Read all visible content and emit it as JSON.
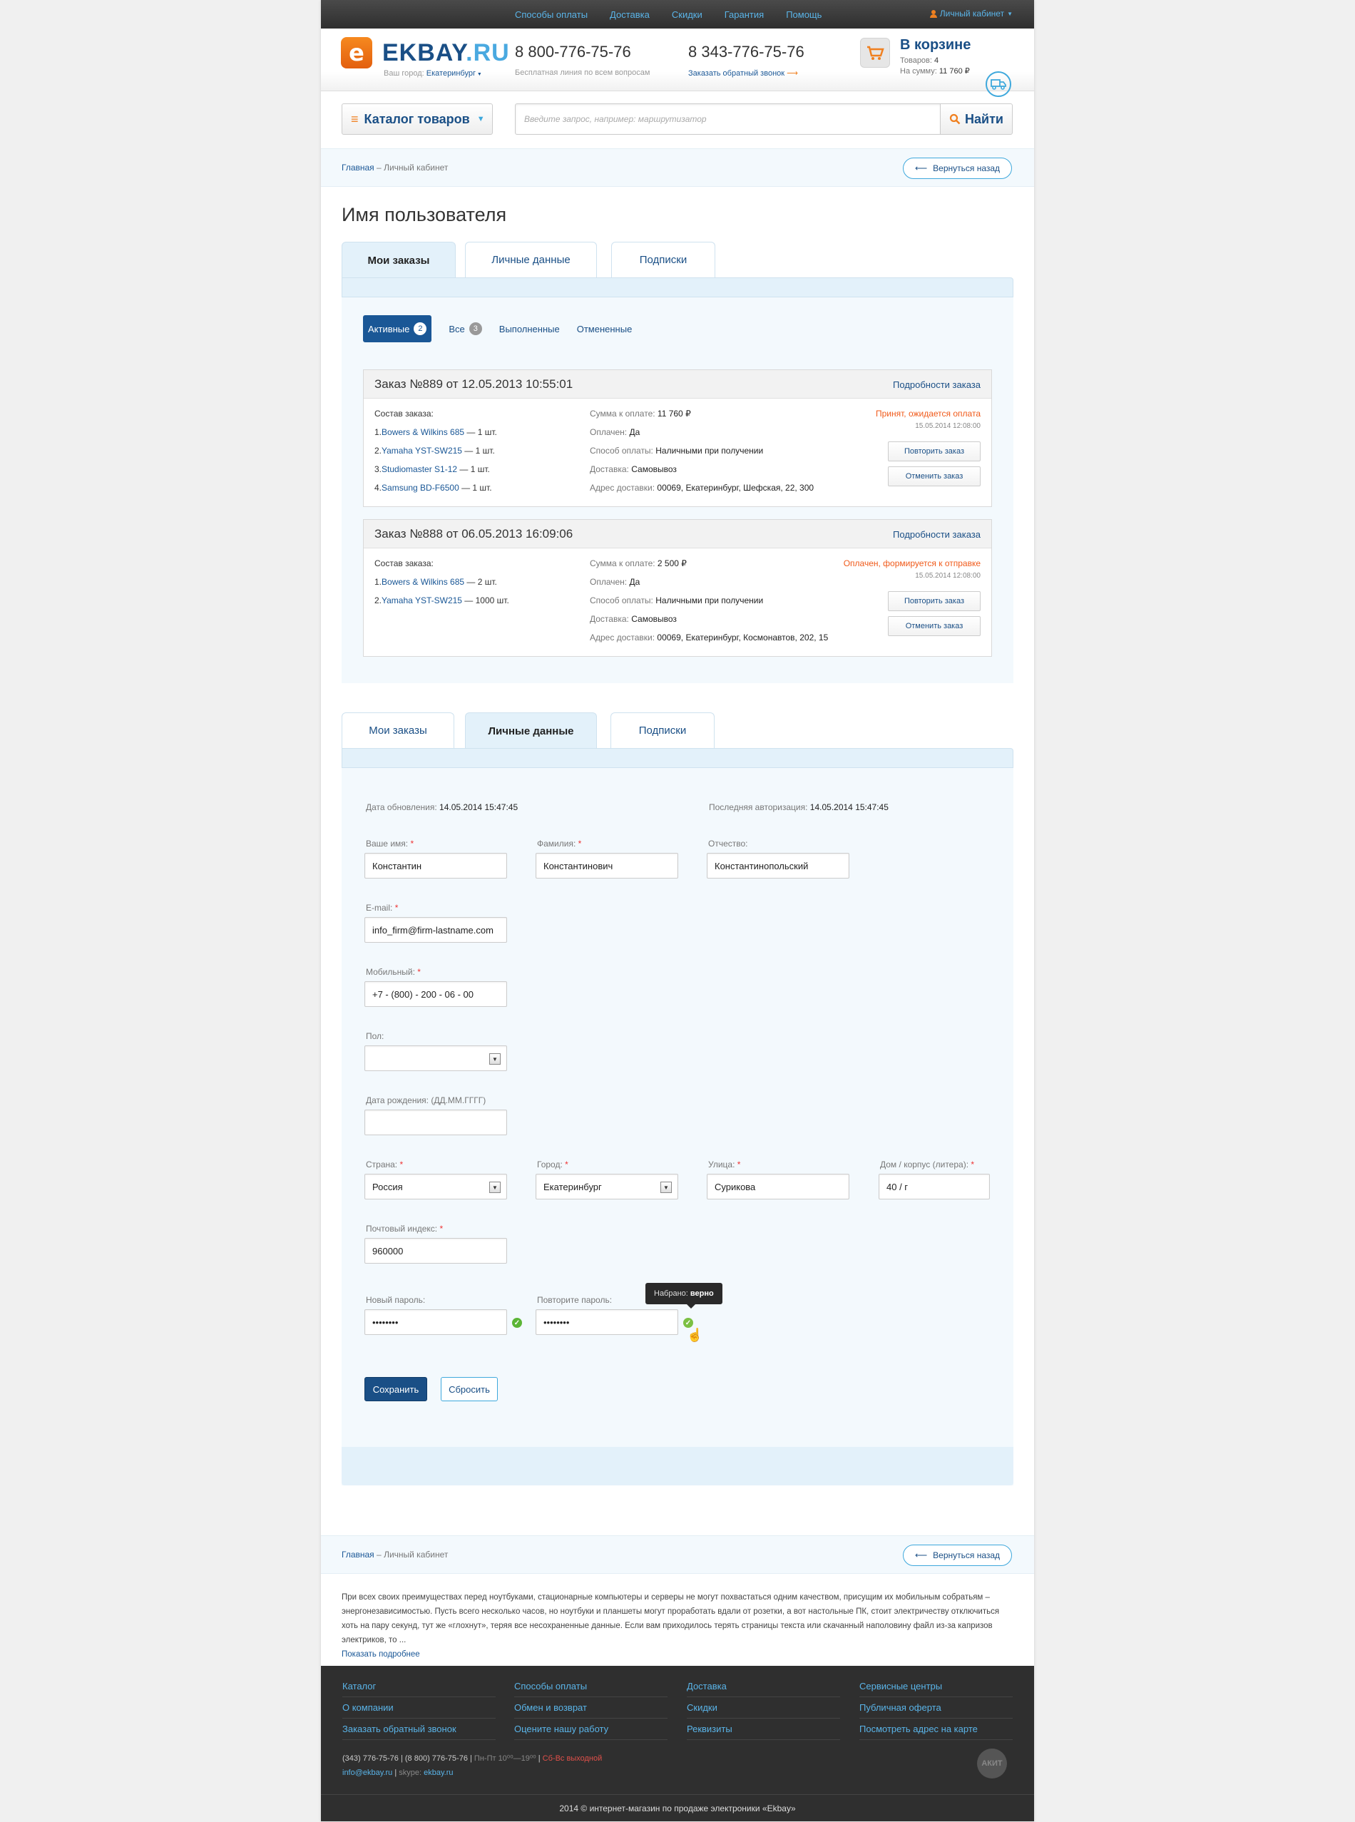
{
  "topbar": {
    "nav": [
      "Способы оплаты",
      "Доставка",
      "Скидки",
      "Гарантия",
      "Помощь"
    ],
    "cabinet": "Личный кабинет"
  },
  "header": {
    "logo_ek": "EKBAY",
    "logo_ru": ".RU",
    "city_label": "Ваш город:",
    "city": "Екатеринбург",
    "phone1": "8 800-776-75-76",
    "phone1_sub": "Бесплатная линия по всем вопросам",
    "phone2": "8 343-776-75-76",
    "phone2_sub": "Заказать обратный звонок",
    "cart_title": "В корзине",
    "cart_items_label": "Товаров:",
    "cart_items": "4",
    "cart_sum_label": "На сумму:",
    "cart_sum": "11 760 ₽"
  },
  "search": {
    "catalog": "Каталог товаров",
    "placeholder": "Введите запрос, например: маршрутизатор",
    "button": "Найти"
  },
  "breadcrumb": {
    "home": "Главная",
    "sep": "–",
    "current": "Личный кабинет",
    "back": "Вернуться назад"
  },
  "page_title": "Имя пользователя",
  "tabs": [
    "Мои заказы",
    "Личные данные",
    "Подписки"
  ],
  "filters": {
    "active": "Активные",
    "active_count": "2",
    "all": "Все",
    "all_count": "3",
    "done": "Выполненные",
    "cancelled": "Отмененные"
  },
  "orders": [
    {
      "title": "Заказ №889 от 12.05.2013 10:55:01",
      "details": "Подробности заказа",
      "composition": "Состав заказа:",
      "items": [
        {
          "num": "1.",
          "name": "Bowers & Wilkins 685",
          "qty": " — 1 шт."
        },
        {
          "num": "2.",
          "name": "Yamaha YST-SW215",
          "qty": " — 1 шт."
        },
        {
          "num": "3.",
          "name": "Studiomaster S1-12",
          "qty": " — 1 шт."
        },
        {
          "num": "4.",
          "name": "Samsung BD-F6500",
          "qty": " — 1 шт."
        }
      ],
      "info": [
        {
          "label": "Сумма к оплате:",
          "value": "11 760 ₽"
        },
        {
          "label": "Оплачен:",
          "value": "Да"
        },
        {
          "label": "Способ оплаты:",
          "value": "Наличными при получении"
        },
        {
          "label": "Доставка:",
          "value": "Самовывоз"
        },
        {
          "label": "Адрес доставки:",
          "value": "00069, Екатеринбург, Шефская, 22, 300"
        }
      ],
      "status": "Принят, ожидается оплата",
      "status_date": "15.05.2014 12:08:00",
      "repeat": "Повторить заказ",
      "cancel": "Отменить заказ"
    },
    {
      "title": "Заказ №888 от 06.05.2013 16:09:06",
      "details": "Подробности заказа",
      "composition": "Состав заказа:",
      "items": [
        {
          "num": "1.",
          "name": "Bowers & Wilkins 685",
          "qty": " — 2 шт."
        },
        {
          "num": "2.",
          "name": "Yamaha YST-SW215",
          "qty": " — 1000 шт."
        }
      ],
      "info": [
        {
          "label": "Сумма к оплате:",
          "value": "2 500 ₽"
        },
        {
          "label": "Оплачен:",
          "value": "Да"
        },
        {
          "label": "Способ оплаты:",
          "value": "Наличными при получении"
        },
        {
          "label": "Доставка:",
          "value": "Самовывоз"
        },
        {
          "label": "Адрес доставки:",
          "value": "00069, Екатеринбург, Космонавтов, 202, 15"
        }
      ],
      "status": "Оплачен, формируется к отправке",
      "status_date": "15.05.2014 12:08:00",
      "repeat": "Повторить заказ",
      "cancel": "Отменить заказ"
    }
  ],
  "profile": {
    "updated_label": "Дата обновления:",
    "updated": "14.05.2014 15:47:45",
    "lastlogin_label": "Последняя авторизация:",
    "lastlogin": "14.05.2014 15:47:45",
    "name_label": "Ваше имя:",
    "name": "Константин",
    "surname_label": "Фамилия:",
    "surname": "Константинович",
    "patronymic_label": "Отчество:",
    "patronymic": "Константинопольский",
    "email_label": "E-mail:",
    "email": "info_firm@firm-lastname.com",
    "mobile_label": "Мобильный:",
    "mobile": "+7 - (800) - 200 - 06 - 00",
    "gender_label": "Пол:",
    "gender": "",
    "birth_label": "Дата рождения: (ДД.ММ.ГГГГ)",
    "birth": "",
    "country_label": "Страна:",
    "country": "Россия",
    "city_label": "Город:",
    "city": "Екатеринбург",
    "street_label": "Улица:",
    "street": "Сурикова",
    "house_label": "Дом / корпус (литера):",
    "house": "40 / г",
    "zip_label": "Почтовый индекс:",
    "zip": "960000",
    "newpass_label": "Новый пароль:",
    "newpass": "••••••••",
    "repeatpass_label": "Повторите пароль:",
    "repeatpass": "••••••••",
    "req": "*",
    "tooltip_label": "Набрано:",
    "tooltip_value": "верно",
    "save": "Сохранить",
    "reset": "Сбросить"
  },
  "description": {
    "text": "При всех своих преимуществах перед ноутбуками, стационарные компьютеры и серверы не могут похвастаться одним качеством, присущим их мобильным собратьям – энергонезависимостью. Пусть всего несколько часов, но ноутбуки и планшеты могут проработать вдали от розетки, а вот настольные ПК, стоит электричеству отключиться хоть на пару секунд, тут же «глохнут», теряя все несохраненные данные. Если вам приходилось терять страницы текста или скачанный наполовину файл из-за капризов электриков, то ...",
    "more": "Показать подробнее"
  },
  "footer": {
    "col1": [
      "Каталог",
      "О компании",
      "Заказать обратный звонок"
    ],
    "col2": [
      "Способы оплаты",
      "Обмен и возврат",
      "Оцените нашу работу"
    ],
    "col3": [
      "Доставка",
      "Скидки",
      "Реквизиты"
    ],
    "col4": [
      "Сервисные центры",
      "Публичная оферта",
      "Посмотреть адрес на карте"
    ],
    "phone1": "(343) 776-75-76",
    "phone2": "(8 800) 776-75-76",
    "hours": "Пн-Пт 10⁰⁰—19⁰⁰",
    "weekend": "Сб-Вс выходной",
    "email": "info@ekbay.ru",
    "skype_label": "skype:",
    "skype": "ekbay.ru",
    "akit": "АКИТ",
    "copyright": "2014 © интернет-магазин по продаже электроники «Ekbay»"
  },
  "colors": {
    "brand": "#1a4f86",
    "accent": "#f08020",
    "link": "#1a5796",
    "light": "#3ea8dc"
  }
}
